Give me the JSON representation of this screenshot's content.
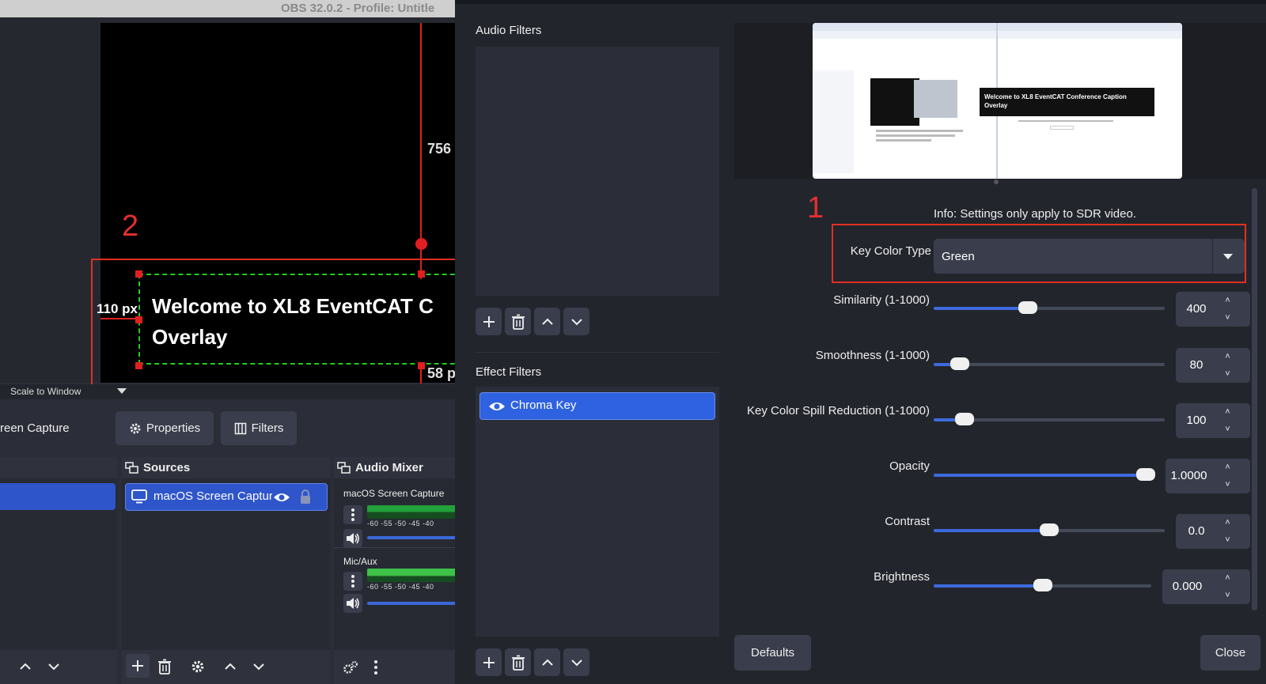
{
  "main_window": {
    "title": "OBS 32.0.2 - Profile: Untitle",
    "preview": {
      "distance_top": "756",
      "distance_left": "110 px",
      "distance_bottom": "58 p",
      "overlay_text_line1": "Welcome to XL8 EventCAT C",
      "overlay_text_line2": "Overlay",
      "annotation_number": "2"
    },
    "scale_dropdown": "Scale to Window",
    "context_source": "reen Capture",
    "properties_button": "Properties",
    "filters_button": "Filters",
    "sources_title": "Sources",
    "source_item": "macOS Screen Capture",
    "mixer_title": "Audio Mixer",
    "mixer_channels": [
      {
        "name": "macOS Screen Capture",
        "scale": "-60  -55  -50  -45  -40"
      },
      {
        "name": "Mic/Aux",
        "scale": "-60  -55  -50  -45  -40"
      }
    ]
  },
  "filters_dialog": {
    "audio_filters_label": "Audio Filters",
    "effect_filters_label": "Effect Filters",
    "effect_filters": [
      "Chroma Key"
    ],
    "preview_screenshot": {
      "heading_line1": "Welcome to XL8 EventCAT Conference Caption",
      "heading_line2": "Overlay"
    },
    "annotation_number": "1",
    "info_text": "Info: Settings only apply to SDR video.",
    "key_color_type_label": "Key Color Type",
    "key_color_type_value": "Green",
    "settings": [
      {
        "label": "Similarity (1-1000)",
        "value": "400",
        "slider_fraction": 0.4
      },
      {
        "label": "Smoothness (1-1000)",
        "value": "80",
        "slider_fraction": 0.08
      },
      {
        "label": "Key Color Spill Reduction (1-1000)",
        "value": "100",
        "slider_fraction": 0.1
      },
      {
        "label": "Opacity",
        "value": "1.0000",
        "slider_fraction": 1.0
      },
      {
        "label": "Contrast",
        "value": "0.0",
        "slider_fraction": 0.5
      },
      {
        "label": "Brightness",
        "value": "0.000",
        "slider_fraction": 0.5
      }
    ],
    "defaults_button": "Defaults",
    "close_button": "Close"
  },
  "colors": {
    "accent_blue": "#2e62e0",
    "annotation_red": "#e03020",
    "guide_green": "#22cc22"
  }
}
